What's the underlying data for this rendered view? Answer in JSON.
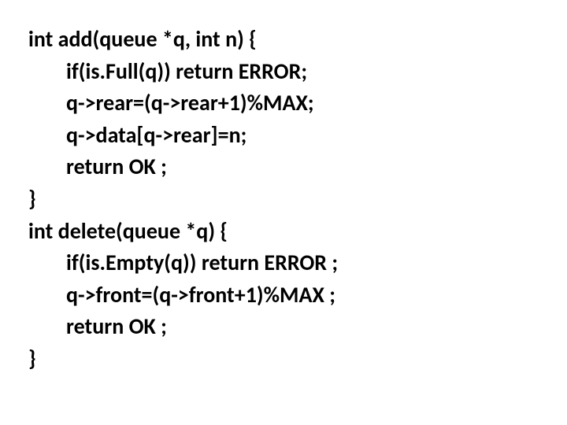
{
  "code": {
    "line1": "int add(queue *q, int n) {",
    "line2": "if(is.Full(q)) return ERROR;",
    "line3": "q->rear=(q->rear+1)%MAX;",
    "line4": "q->data[q->rear]=n;",
    "line5": "return OK ;",
    "line6": "}",
    "line7": "int delete(queue *q) {",
    "line8": "if(is.Empty(q)) return ERROR ;",
    "line9": "q->front=(q->front+1)%MAX ;",
    "line10": "return OK ;",
    "line11": "}"
  }
}
